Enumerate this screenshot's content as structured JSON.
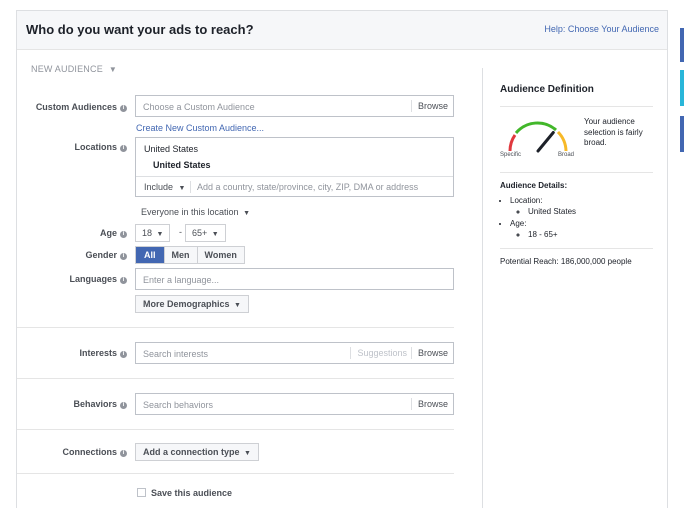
{
  "header": {
    "title": "Who do you want your ads to reach?",
    "help": "Help: Choose Your Audience"
  },
  "new_audience": "NEW AUDIENCE",
  "custom_audiences": {
    "label": "Custom Audiences",
    "placeholder": "Choose a Custom Audience",
    "browse": "Browse",
    "create_link": "Create New Custom Audience..."
  },
  "locations": {
    "label": "Locations",
    "country": "United States",
    "selected": "United States",
    "include": "Include",
    "placeholder": "Add a country, state/province, city, ZIP, DMA or address",
    "scope": "Everyone in this location"
  },
  "age": {
    "label": "Age",
    "min": "18",
    "max": "65+",
    "dash": "-"
  },
  "gender": {
    "label": "Gender",
    "options": [
      "All",
      "Men",
      "Women"
    ],
    "selected": "All"
  },
  "languages": {
    "label": "Languages",
    "placeholder": "Enter a language..."
  },
  "more_demographics": "More Demographics",
  "interests": {
    "label": "Interests",
    "placeholder": "Search interests",
    "suggestions": "Suggestions",
    "browse": "Browse"
  },
  "behaviors": {
    "label": "Behaviors",
    "placeholder": "Search behaviors",
    "browse": "Browse"
  },
  "connections": {
    "label": "Connections",
    "button": "Add a connection type"
  },
  "save": {
    "label": "Save this audience"
  },
  "sidebar": {
    "title": "Audience Definition",
    "description": "Your audience selection is fairly broad.",
    "gauge": {
      "left_label": "Specific",
      "right_label": "Broad",
      "level": 0.72
    },
    "details_title": "Audience Details:",
    "location_label": "Location:",
    "location_value": "United States",
    "age_label": "Age:",
    "age_value": "18 - 65+",
    "reach": "Potential Reach: 186,000,000 people"
  },
  "colors": {
    "accent": "#4267b2",
    "gauge_red": "#e0393e",
    "gauge_green": "#42b72a",
    "gauge_yellow": "#f7b928"
  }
}
